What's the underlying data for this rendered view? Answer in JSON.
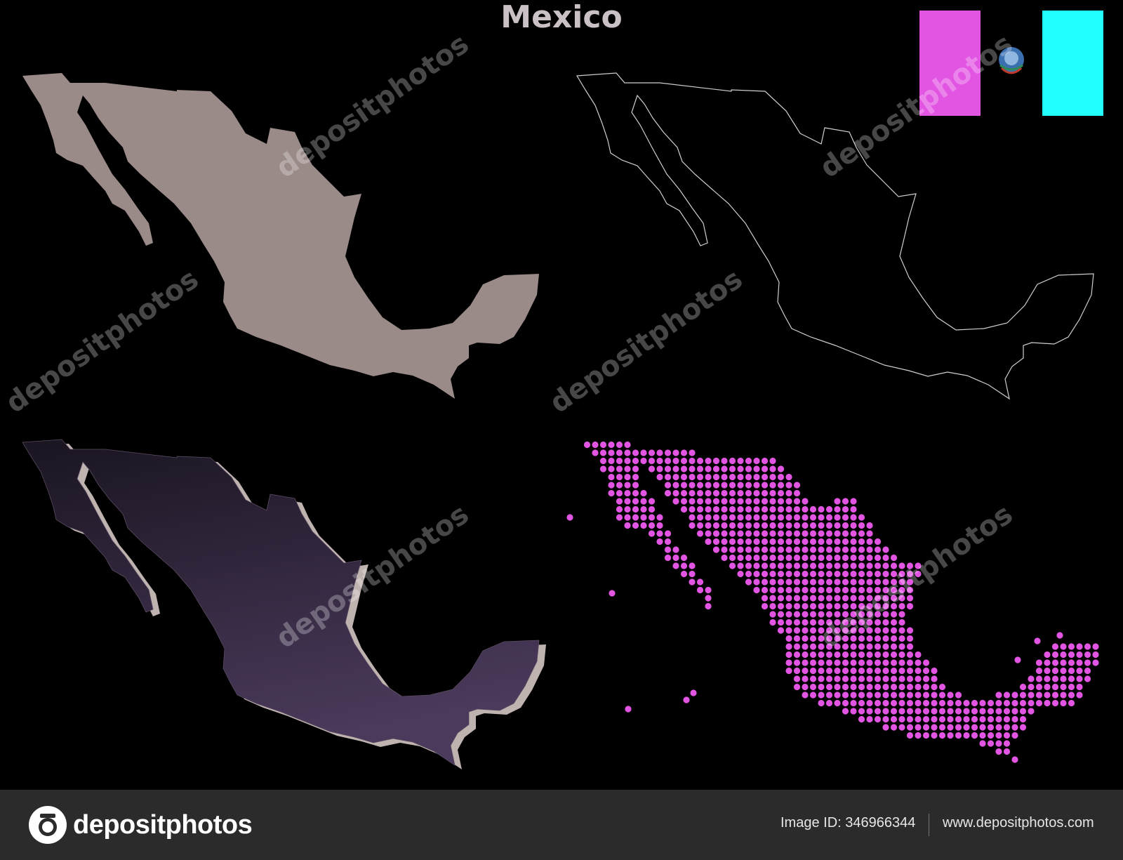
{
  "title": "Mexico",
  "colors": {
    "solid_fill": "#9a8a88",
    "outline_stroke": "#cfcfcf",
    "gradient_top": "#1a1520",
    "gradient_bottom": "#4a3a5c",
    "gradient_shadow": "#bfb3b0",
    "dots": "#e255e2",
    "flag_left": "#e255e2",
    "flag_right": "#22ffff"
  },
  "flag": {
    "emblem": "eagle-emblem-icon"
  },
  "watermark_text": "depositphotos",
  "footer": {
    "logo_text": "depositphotos",
    "image_id": "Image ID: 346966344",
    "site": "www.depositphotos.com"
  }
}
